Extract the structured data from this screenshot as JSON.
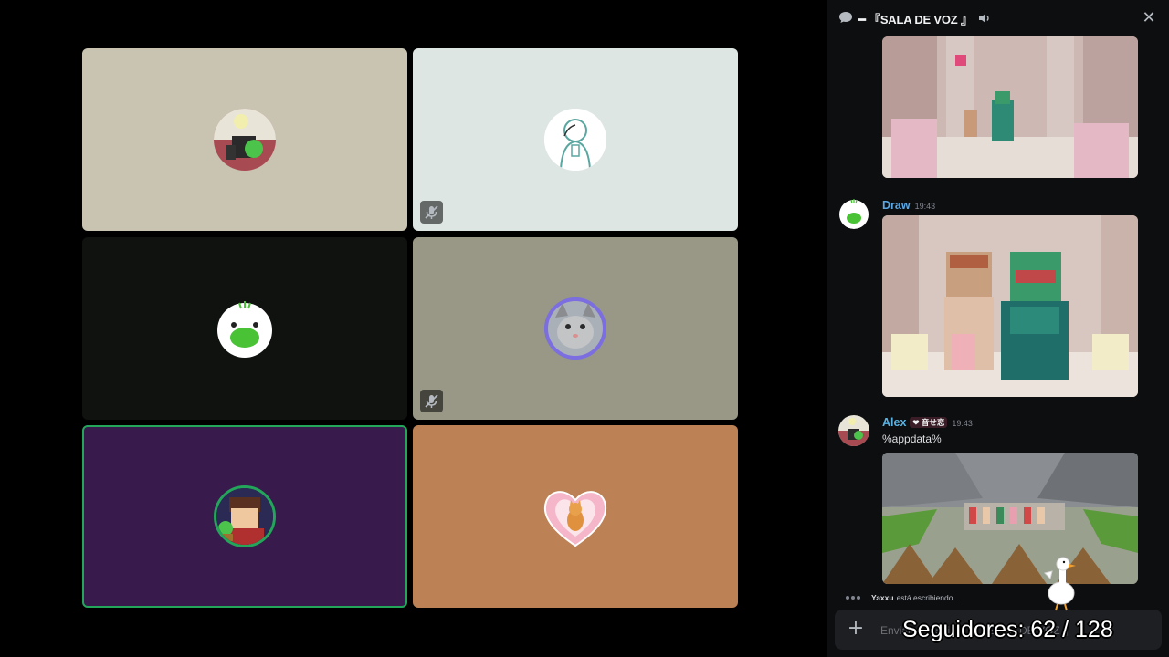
{
  "colors": {
    "app_bg": "#000000",
    "panel_bg": "#0d0e10",
    "speaking_ring": "#23a55a",
    "author_draw": "#5aa9e6",
    "author_alex": "#58b4e6"
  },
  "voice_grid": {
    "tiles": [
      {
        "bg": "#c8c4b1",
        "avatar": "pixel-character-avatar",
        "muted": false,
        "speaking": false
      },
      {
        "bg": "#dde6e3",
        "avatar": "sketch-character-avatar",
        "muted": true,
        "speaking": false
      },
      {
        "bg": "#0f120f",
        "avatar": "green-blob-avatar",
        "muted": false,
        "speaking": false
      },
      {
        "bg": "#999887",
        "avatar": "cat-photo-avatar",
        "muted": true,
        "speaking": false
      },
      {
        "bg": "#381a4c",
        "avatar": "pixel-boy-avatar",
        "muted": false,
        "speaking": true
      },
      {
        "bg": "#bc8155",
        "avatar": "heart-cat-avatar",
        "muted": false,
        "speaking": false
      }
    ]
  },
  "chat": {
    "header": {
      "title": "━ 『SALA DE VOZ 』",
      "chat_icon": "chat-bubble-icon",
      "speaker_icon": "speaker-icon",
      "close_icon": "close-icon"
    },
    "messages": [
      {
        "author": "Draw",
        "time": "19:43",
        "badge": "",
        "text": "",
        "attachment": "minecraft-screenshot-two-players"
      },
      {
        "author": "Alex",
        "time": "19:43",
        "badge": "❤ 音せ恋",
        "text": "%appdata%",
        "attachment": "minecraft-screenshot-crowd"
      }
    ],
    "typing": {
      "user": "Yaxxu",
      "text": "está escribiendo..."
    },
    "composer": {
      "placeholder": "Enviar mensaje a ━ 『SALA DE VOZ 』"
    }
  },
  "overlay": {
    "followers_label": "Seguidores: 62 / 128"
  }
}
